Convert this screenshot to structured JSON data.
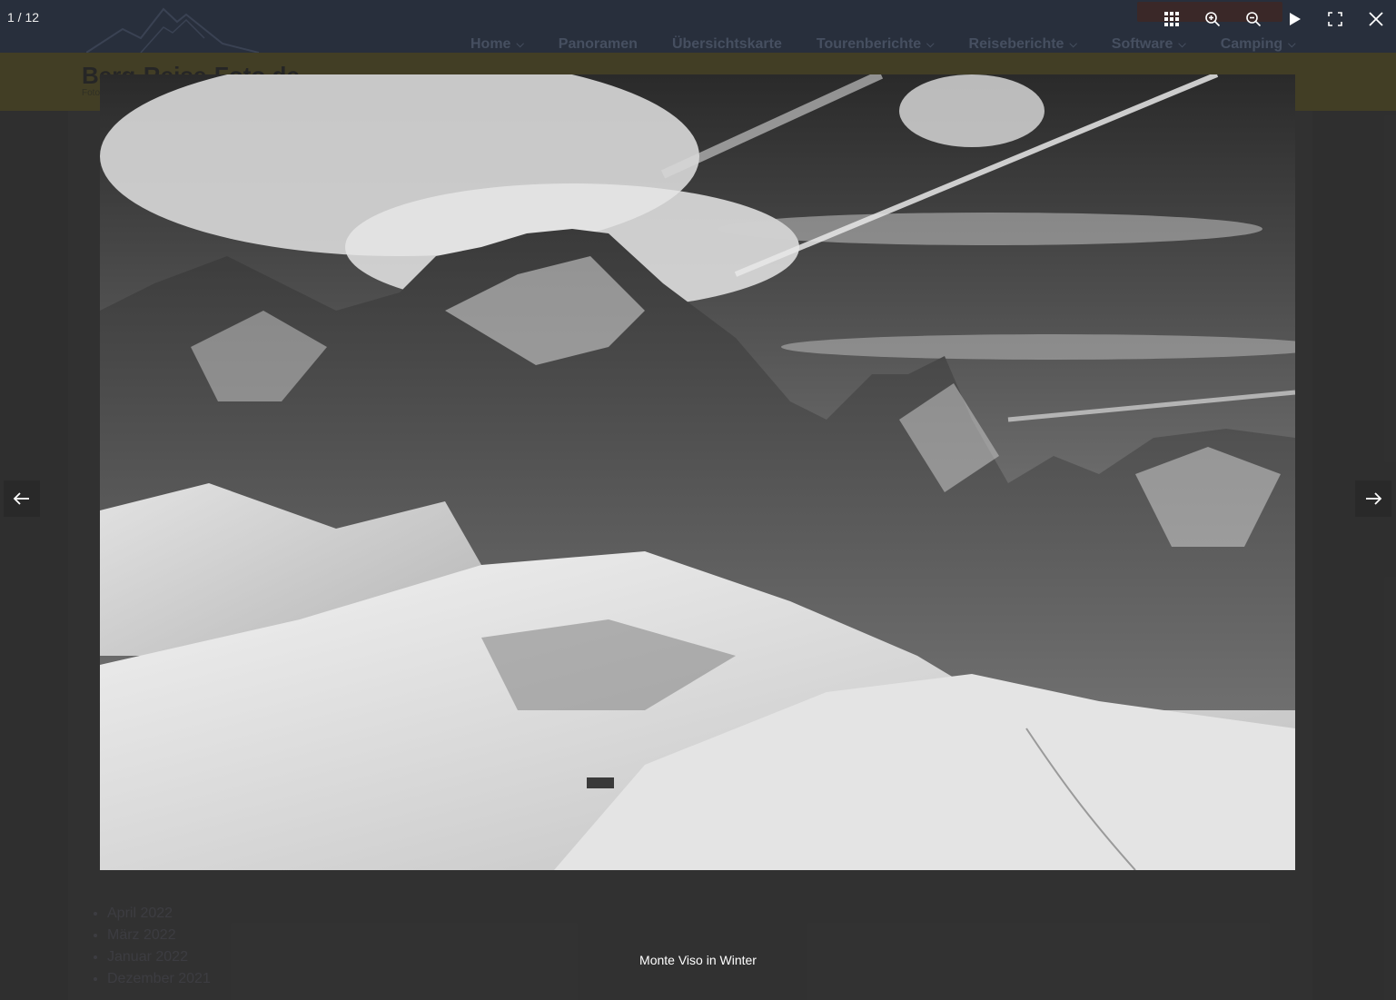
{
  "lightbox": {
    "counter": "1 / 12",
    "caption": "Monte Viso in Winter",
    "toolbar": {
      "thumbnails_icon": "grid-icon",
      "zoom_in_icon": "zoom-in-icon",
      "zoom_out_icon": "zoom-out-icon",
      "slideshow_icon": "play-icon",
      "fullscreen_icon": "fullscreen-icon",
      "close_icon": "close-icon"
    },
    "prev_icon": "arrow-left-icon",
    "next_icon": "arrow-right-icon"
  },
  "site": {
    "title": "Berg-Reise-Foto.de",
    "tagline": "Foto",
    "nav": [
      {
        "label": "Home"
      },
      {
        "label": "Panoramen"
      },
      {
        "label": "Übersichtskarte"
      },
      {
        "label": "Tourenberichte"
      },
      {
        "label": "Reiseberichte"
      },
      {
        "label": "Software"
      },
      {
        "label": "Camping"
      }
    ],
    "archive": [
      "April 2022",
      "März 2022",
      "Januar 2022",
      "Dezember 2021"
    ]
  },
  "colors": {
    "overlay_text": "#ffffff",
    "header_bg": "#2f3a4e",
    "banner_bg": "#57502a"
  }
}
